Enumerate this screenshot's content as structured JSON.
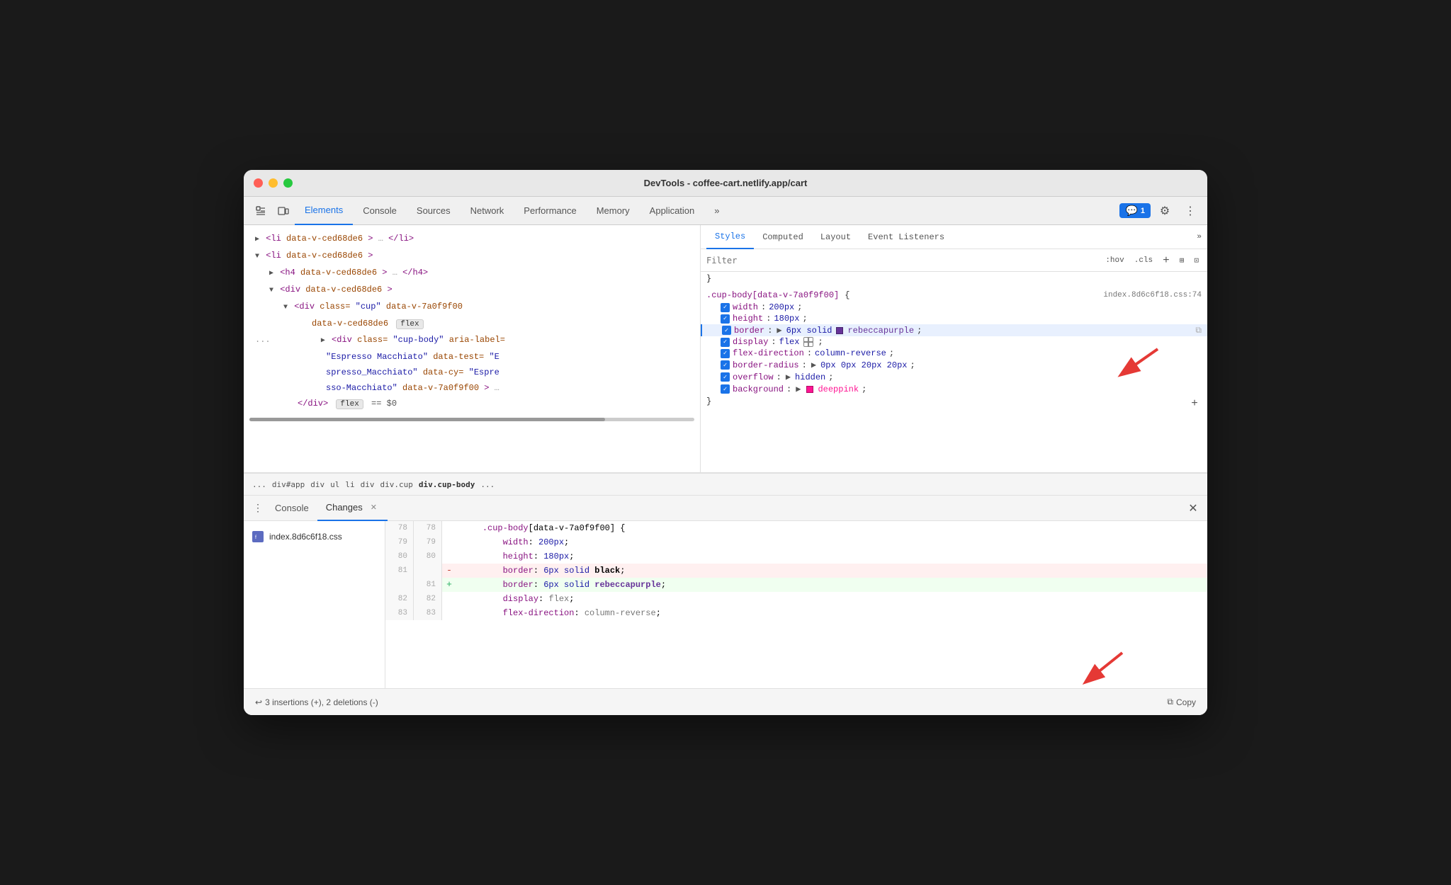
{
  "window": {
    "title": "DevTools - coffee-cart.netlify.app/cart"
  },
  "devtools": {
    "tabs": [
      {
        "label": "Elements",
        "active": true
      },
      {
        "label": "Console"
      },
      {
        "label": "Sources"
      },
      {
        "label": "Network"
      },
      {
        "label": "Performance"
      },
      {
        "label": "Memory"
      },
      {
        "label": "Application"
      }
    ],
    "more_tabs": "»",
    "chat_badge": "1"
  },
  "dom_panel": {
    "lines": [
      {
        "indent": 0,
        "html": "▶ <li data-v-ced68de6>…</li>"
      },
      {
        "indent": 0,
        "html": "▼ <li data-v-ced68de6>"
      },
      {
        "indent": 1,
        "html": "▶ <h4 data-v-ced68de6>…</h4>"
      },
      {
        "indent": 1,
        "html": "▼ <div data-v-ced68de6>"
      },
      {
        "indent": 2,
        "html": "▼ <div class=\"cup\" data-v-7a0f9f00 data-v-ced68de6>"
      },
      {
        "indent": 3,
        "html": "▶ <div class=\"cup-body\" aria-label= \"Espresso Macchiato\" data-test=\"E spresso_Macchiato\" data-cy=\"Espre sso-Macchiato\" data-v-7a0f9f00>"
      },
      {
        "indent": 3,
        "html": "</div>"
      }
    ]
  },
  "breadcrumb": {
    "items": [
      "...",
      "div#app",
      "div",
      "ul",
      "li",
      "div",
      "div.cup",
      "div.cup-body",
      "..."
    ]
  },
  "styles_panel": {
    "tabs": [
      "Styles",
      "Computed",
      "Layout",
      "Event Listeners"
    ],
    "filter_placeholder": "Filter",
    "filter_btns": [
      ":hov",
      ".cls",
      "+",
      "⊞",
      "⊡"
    ],
    "rule": {
      "selector": ".cup-body[data-v-7a0f9f00]",
      "source": "index.8d6c6f18.css:74",
      "open_brace": "{",
      "properties": [
        {
          "checked": true,
          "name": "width",
          "value": "200px"
        },
        {
          "checked": true,
          "name": "height",
          "value": "180px"
        },
        {
          "checked": true,
          "name": "border",
          "value": "6px solid",
          "swatch": "rebeccapurple",
          "swatch_val": "rebeccapurple",
          "highlighted": true
        },
        {
          "checked": true,
          "name": "display",
          "value": "flex"
        },
        {
          "checked": true,
          "name": "flex-direction",
          "value": "column-reverse"
        },
        {
          "checked": true,
          "name": "border-radius",
          "value": "0px 0px 20px 20px"
        },
        {
          "checked": true,
          "name": "overflow",
          "value": "hidden"
        },
        {
          "checked": true,
          "name": "background",
          "value": "deeppink",
          "swatch": "deeppink"
        }
      ],
      "close_brace": "}"
    }
  },
  "bottom_panel": {
    "tabs": [
      {
        "label": "Console"
      },
      {
        "label": "Changes",
        "active": true,
        "closeable": true
      }
    ]
  },
  "changes": {
    "file": "index.8d6c6f18.css",
    "diff_lines": [
      {
        "num1": "78",
        "num2": "78",
        "sign": " ",
        "code": "    .cup-body[data-v-7a0f9f00] {"
      },
      {
        "num1": "79",
        "num2": "79",
        "sign": " ",
        "code": "        width: 200px;"
      },
      {
        "num1": "80",
        "num2": "80",
        "sign": " ",
        "code": "        height: 180px;"
      },
      {
        "num1": "81",
        "num2": "",
        "sign": "-",
        "code": "        border: 6px solid black;",
        "type": "del",
        "highlight_word": "black"
      },
      {
        "num1": "",
        "num2": "81",
        "sign": "+",
        "code": "        border: 6px solid rebeccapurple;",
        "type": "add",
        "highlight_word": "rebeccapurple"
      },
      {
        "num1": "82",
        "num2": "82",
        "sign": " ",
        "code": "        display: flex;"
      },
      {
        "num1": "83",
        "num2": "83",
        "sign": " ",
        "code": "        flex-direction: column-reverse;"
      }
    ],
    "footer": {
      "undo_icon": "↩",
      "undo_text": "3 insertions (+), 2 deletions (-)",
      "copy_icon": "⧉",
      "copy_text": "Copy"
    }
  }
}
